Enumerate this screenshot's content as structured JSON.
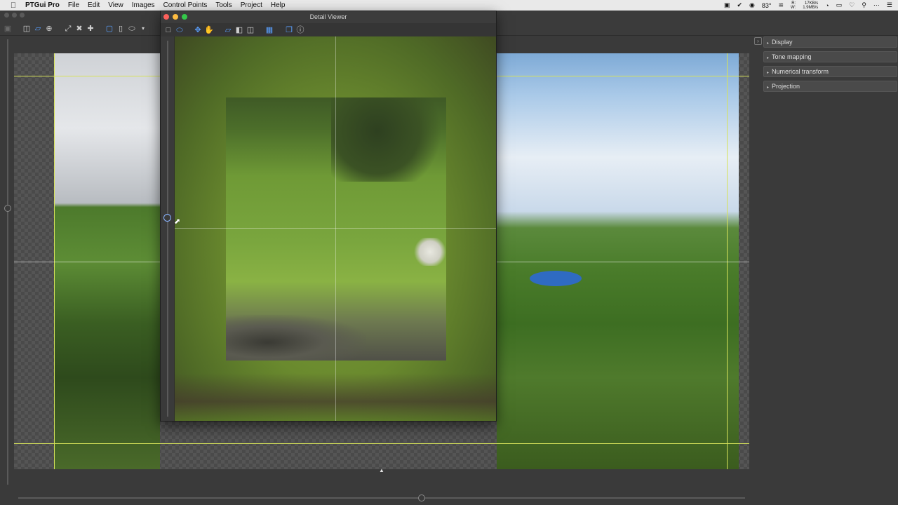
{
  "menubar": {
    "apple_icon": "apple-logo",
    "app_name": "PTGui Pro",
    "menus": [
      "File",
      "Edit",
      "View",
      "Images",
      "Control Points",
      "Tools",
      "Project",
      "Help"
    ],
    "status": {
      "temperature": "83°",
      "net_rate_in": "17KB/s",
      "net_rate_out": "1.9MB/s",
      "net_label_r": "R:",
      "net_label_w": "W:"
    }
  },
  "detail_viewer": {
    "title": "Detail Viewer"
  },
  "side_panel": {
    "toggle": "›",
    "sections": [
      "Display",
      "Tone mapping",
      "Numerical transform",
      "Projection"
    ]
  },
  "bottom_marker": "▲",
  "colors": {
    "accent": "#5aa0ff",
    "guide_line": "#d6e25a",
    "close_light": "#fc605b",
    "minimize_light": "#fdbc40",
    "zoom_light": "#34c84a"
  }
}
